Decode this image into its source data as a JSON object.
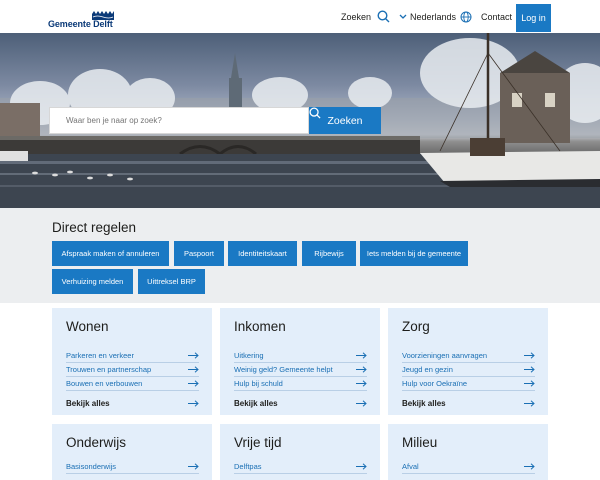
{
  "header": {
    "logo_text": "Gemeente Delft",
    "search_label": "Zoeken",
    "language_label": "Nederlands",
    "contact_label": "Contact",
    "login_label": "Log in"
  },
  "hero": {
    "search_placeholder": "Waar ben je naar op zoek?",
    "search_button": "Zoeken"
  },
  "direct": {
    "title": "Direct regelen",
    "buttons": [
      "Afspraak maken of annuleren",
      "Paspoort",
      "Identiteitskaart",
      "Rijbewijs",
      "Iets melden bij de gemeente",
      "Verhuizing melden",
      "Uittreksel BRP"
    ]
  },
  "cards": [
    {
      "title": "Wonen",
      "links": [
        "Parkeren en verkeer",
        "Trouwen en partnerschap",
        "Bouwen en verbouwen"
      ],
      "all": "Bekijk alles"
    },
    {
      "title": "Inkomen",
      "links": [
        "Uitkering",
        "Weinig geld? Gemeente helpt",
        "Hulp bij schuld"
      ],
      "all": "Bekijk alles"
    },
    {
      "title": "Zorg",
      "links": [
        "Voorzieningen aanvragen",
        "Jeugd en gezin",
        "Hulp voor Oekraïne"
      ],
      "all": "Bekijk alles"
    },
    {
      "title": "Onderwijs",
      "links": [
        "Basisonderwijs"
      ]
    },
    {
      "title": "Vrije tijd",
      "links": [
        "Delftpas"
      ]
    },
    {
      "title": "Milieu",
      "links": [
        "Afval"
      ]
    }
  ],
  "colors": {
    "brand_blue": "#1a79c4",
    "card_bg": "#e3eefa",
    "band_bg": "#eceef0"
  }
}
